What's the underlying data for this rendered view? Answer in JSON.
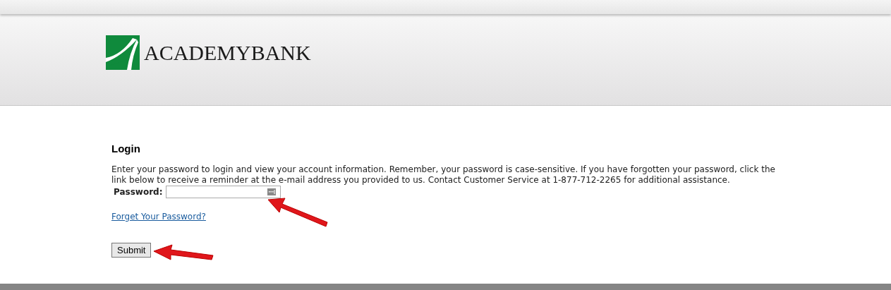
{
  "header": {
    "logo_text": "ACADEMYBANK"
  },
  "login": {
    "title": "Login",
    "instructions": "Enter your password to login and view your account information. Remember, your password is case-sensitive. If you have forgotten your password, click the link below to receive a reminder at the e-mail address you provided to us. Contact Customer Service at 1-877-712-2265 for additional assistance.",
    "password_label": "Password:",
    "forgot_link": "Forget Your Password?",
    "submit": "Submit"
  }
}
